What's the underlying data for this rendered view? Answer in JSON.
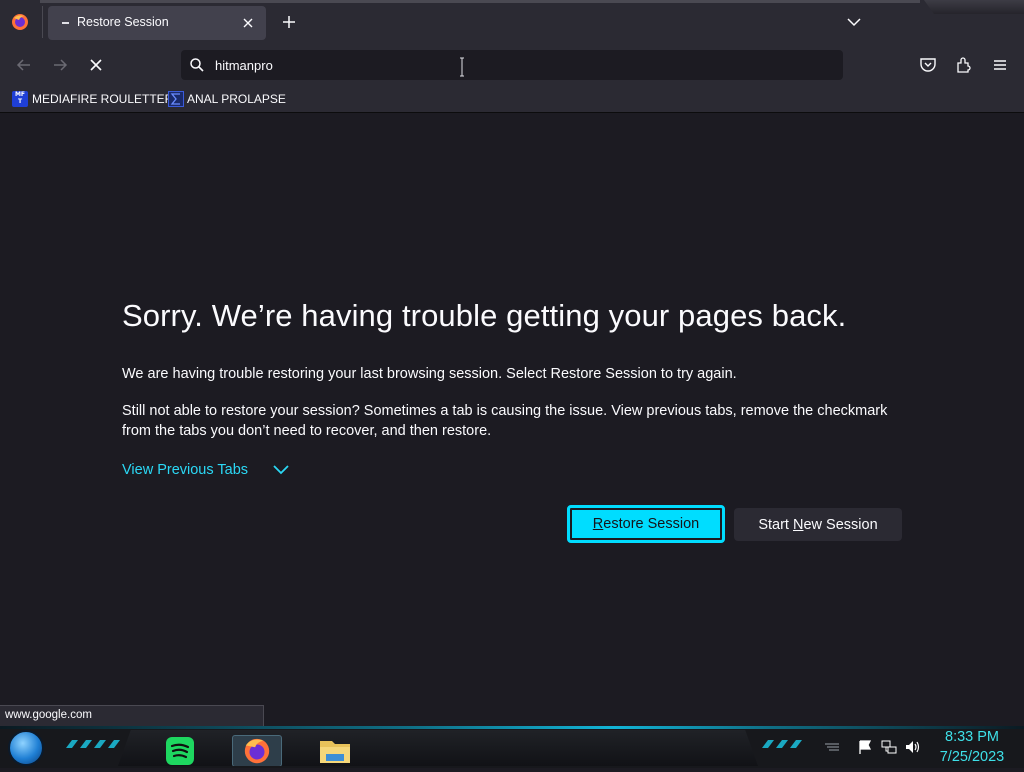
{
  "browser": {
    "tab": {
      "title": "Restore Session",
      "favicon": "dash-icon"
    },
    "url_text": "hitmanpro",
    "bookmarks": [
      {
        "label": "MEDIAFIRE ROULETTER",
        "icon": "mediafire-icon",
        "icon_text": "MF T"
      },
      {
        "label": "ANAL PROLAPSE",
        "icon": "sigma-icon"
      }
    ]
  },
  "page": {
    "heading": "Sorry. We’re having trouble getting your pages back.",
    "para1": "We are having trouble restoring your last browsing session. Select Restore Session to try again.",
    "para2": "Still not able to restore your session? Sometimes a tab is causing the issue. View previous tabs, remove the checkmark from the tabs you don’t need to recover, and then restore.",
    "view_tabs_label": "View Previous Tabs",
    "restore_button": {
      "pre": "",
      "accel": "R",
      "post": "estore Session"
    },
    "new_session_button": {
      "pre": "Start ",
      "accel": "N",
      "post": "ew Session"
    },
    "status_url": "www.google.com"
  },
  "taskbar": {
    "time": "8:33 PM",
    "date": "7/25/2023",
    "apps": [
      "spotify-icon",
      "firefox-icon",
      "file-explorer-icon"
    ]
  },
  "colors": {
    "accent": "#00ddff",
    "link": "#2bd8f5",
    "background": "#1c1b22",
    "toolbar": "#2b2a33",
    "clock": "#3ee0e8"
  }
}
